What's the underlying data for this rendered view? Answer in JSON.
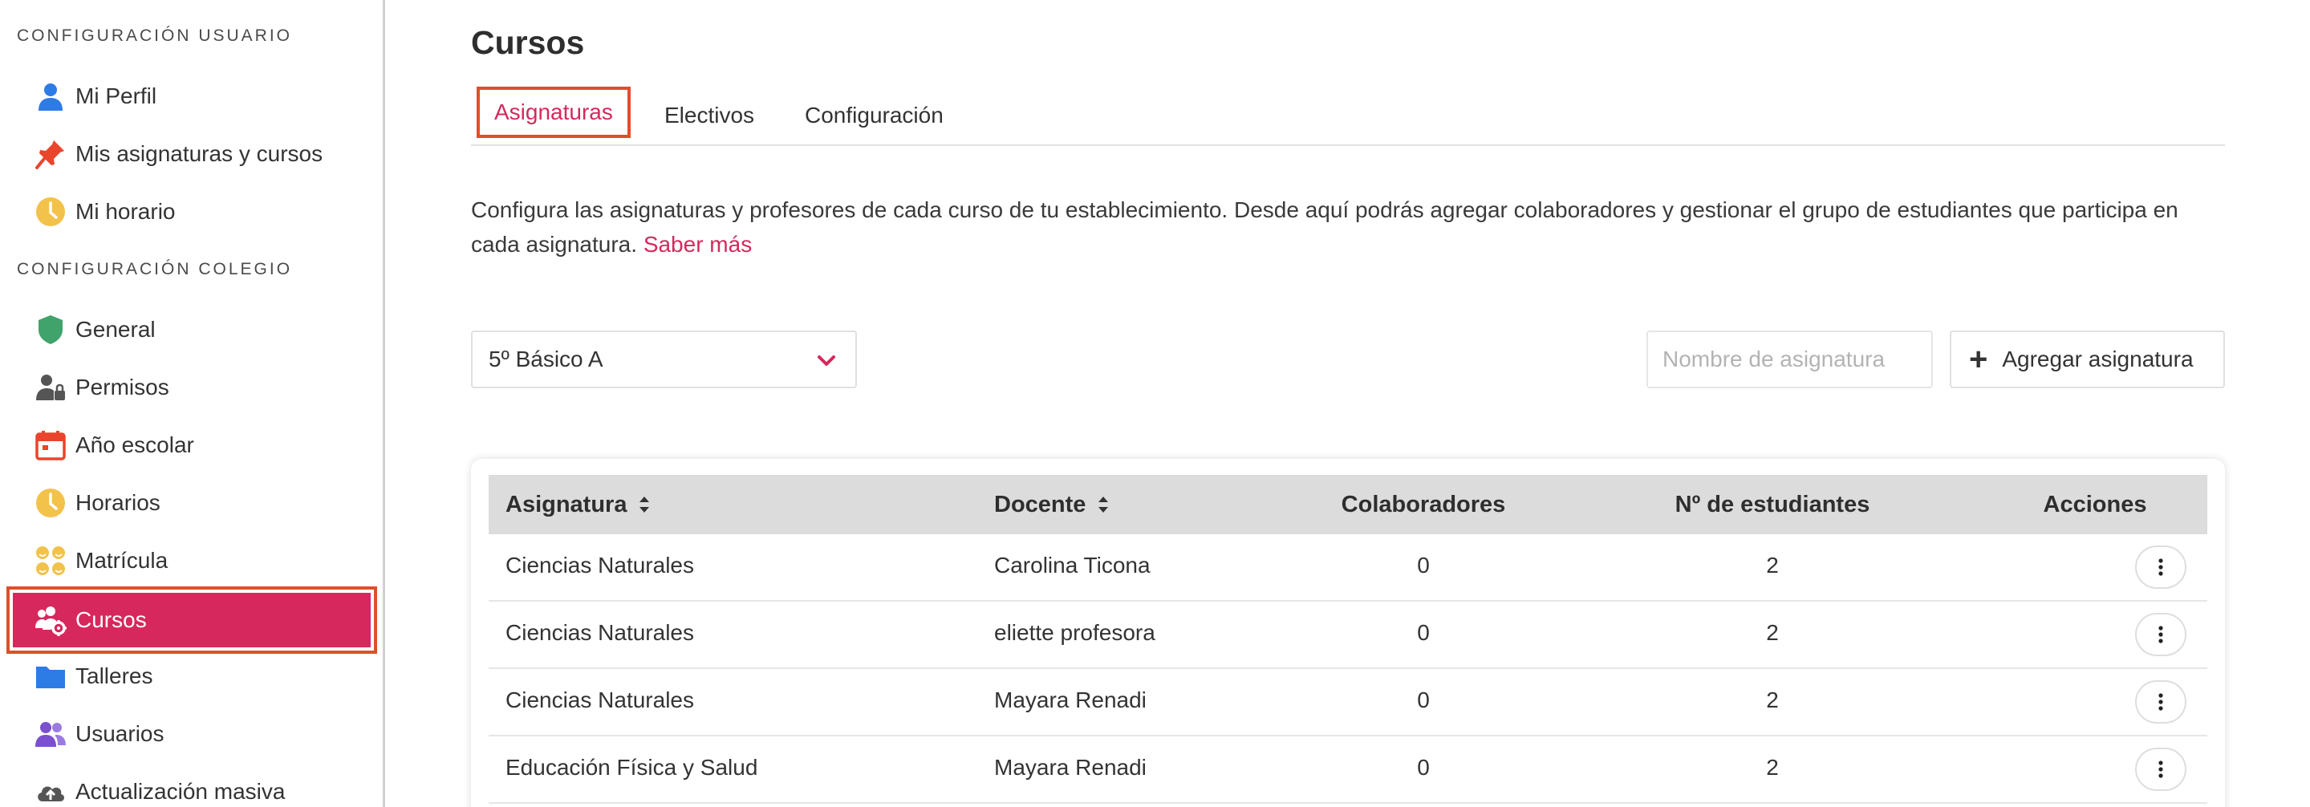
{
  "sidebar": {
    "section_user": "CONFIGURACIÓN USUARIO",
    "section_school": "CONFIGURACIÓN COLEGIO",
    "user_items": [
      {
        "label": "Mi Perfil",
        "icon": "user-icon"
      },
      {
        "label": "Mis asignaturas y cursos",
        "icon": "pin-icon"
      },
      {
        "label": "Mi horario",
        "icon": "clock-icon"
      }
    ],
    "school_items": [
      {
        "label": "General",
        "icon": "shield-icon"
      },
      {
        "label": "Permisos",
        "icon": "user-lock-icon"
      },
      {
        "label": "Año escolar",
        "icon": "calendar-icon"
      },
      {
        "label": "Horarios",
        "icon": "clock-icon"
      },
      {
        "label": "Matrícula",
        "icon": "faces-icon"
      },
      {
        "label": "Cursos",
        "icon": "users-gear-icon",
        "active": true
      },
      {
        "label": "Talleres",
        "icon": "folder-icon"
      },
      {
        "label": "Usuarios",
        "icon": "users-icon"
      },
      {
        "label": "Actualización masiva",
        "icon": "cloud-upload-icon"
      }
    ]
  },
  "header": {
    "title": "Cursos"
  },
  "tabs": [
    {
      "label": "Asignaturas",
      "active": true
    },
    {
      "label": "Electivos"
    },
    {
      "label": "Configuración"
    }
  ],
  "description": {
    "text": "Configura las asignaturas y profesores de cada curso de tu establecimiento. Desde aquí podrás agregar colaboradores y gestionar el grupo de estudiantes que participa en cada asignatura. ",
    "link": "Saber más"
  },
  "controls": {
    "course_select_value": "5º Básico A",
    "search_placeholder": "Nombre de asignatura",
    "add_button_label": "Agregar asignatura"
  },
  "table": {
    "headers": [
      "Asignatura",
      "Docente",
      "Colaboradores",
      "Nº de estudiantes",
      "Acciones"
    ],
    "rows": [
      {
        "asignatura": "Ciencias Naturales",
        "docente": "Carolina Ticona",
        "colaboradores": "0",
        "estudiantes": "2"
      },
      {
        "asignatura": "Ciencias Naturales",
        "docente": "eliette profesora",
        "colaboradores": "0",
        "estudiantes": "2"
      },
      {
        "asignatura": "Ciencias Naturales",
        "docente": "Mayara Renadi",
        "colaboradores": "0",
        "estudiantes": "2"
      },
      {
        "asignatura": "Educación Física y Salud",
        "docente": "Mayara Renadi",
        "colaboradores": "0",
        "estudiantes": "2"
      }
    ]
  },
  "colors": {
    "accent": "#d6285c",
    "highlight_outline": "#e04e2c",
    "header_bg": "#dcdcdc"
  }
}
